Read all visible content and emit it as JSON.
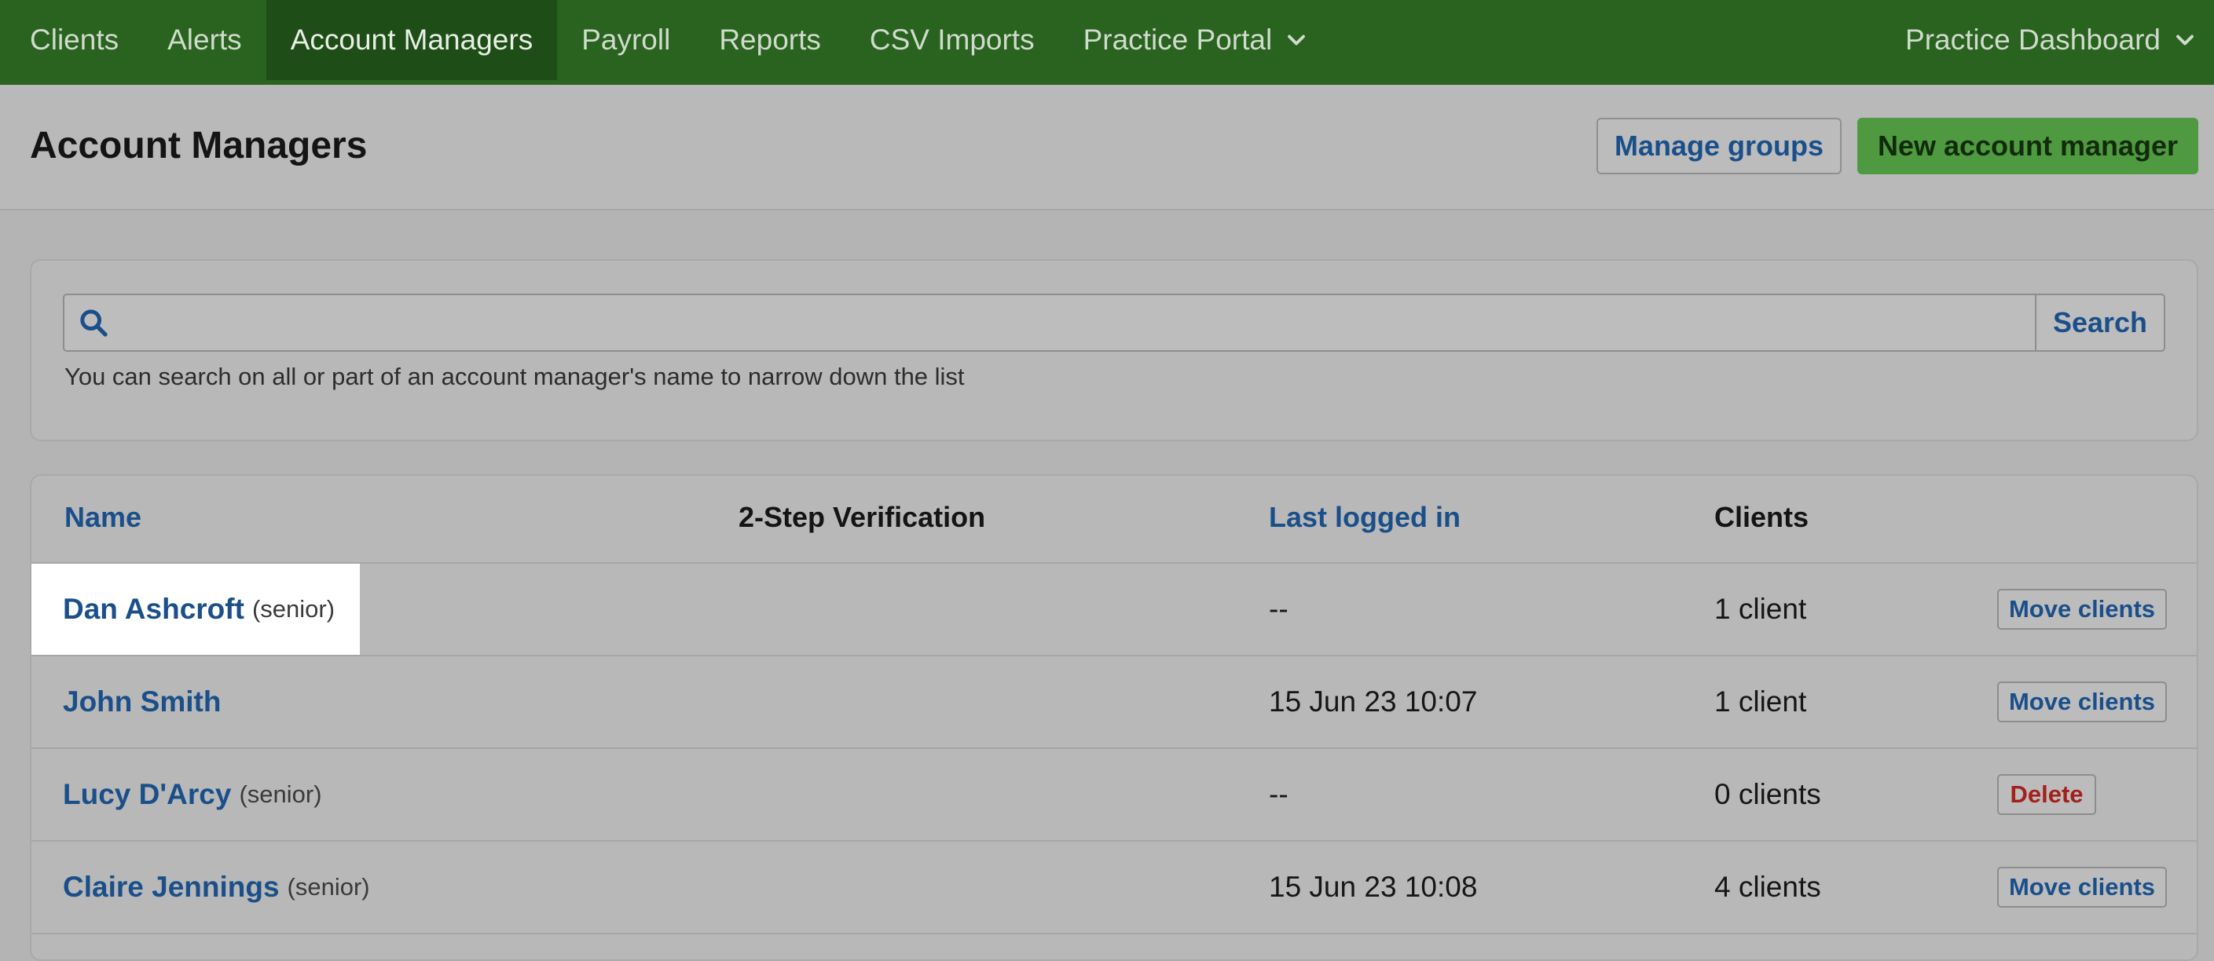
{
  "nav": {
    "items": [
      {
        "label": "Clients"
      },
      {
        "label": "Alerts"
      },
      {
        "label": "Account Managers"
      },
      {
        "label": "Payroll"
      },
      {
        "label": "Reports"
      },
      {
        "label": "CSV Imports"
      },
      {
        "label": "Practice Portal"
      }
    ],
    "active_index": 2,
    "right_label": "Practice Dashboard"
  },
  "header": {
    "title": "Account Managers",
    "manage_groups_label": "Manage groups",
    "new_manager_label": "New account manager"
  },
  "search": {
    "value": "",
    "button_label": "Search",
    "help_text": "You can search on all or part of an account manager's name to narrow down the list"
  },
  "table": {
    "columns": [
      "Name",
      "2-Step Verification",
      "Last logged in",
      "Clients"
    ],
    "rows": [
      {
        "name": "Dan Ashcroft",
        "role": "(senior)",
        "verification": "",
        "last_logged_in": "--",
        "clients": "1 client",
        "action": "Move clients",
        "highlighted": true
      },
      {
        "name": "John Smith",
        "role": "",
        "verification": "",
        "last_logged_in": "15 Jun 23 10:07",
        "clients": "1 client",
        "action": "Move clients",
        "highlighted": false
      },
      {
        "name": "Lucy D'Arcy",
        "role": "(senior)",
        "verification": "",
        "last_logged_in": "--",
        "clients": "0 clients",
        "action": "Delete",
        "highlighted": false
      },
      {
        "name": "Claire Jennings",
        "role": "(senior)",
        "verification": "",
        "last_logged_in": "15 Jun 23 10:08",
        "clients": "4 clients",
        "action": "Move clients",
        "highlighted": false
      }
    ]
  },
  "colors": {
    "nav_bg": "#2a6220",
    "nav_active_bg": "#1f4d17",
    "link_blue": "#1a4f8a",
    "primary_green": "#4f9a40",
    "delete_red": "#a3201c"
  },
  "icons": {
    "search": "search-icon",
    "dropdown": "chevron-down-icon"
  }
}
